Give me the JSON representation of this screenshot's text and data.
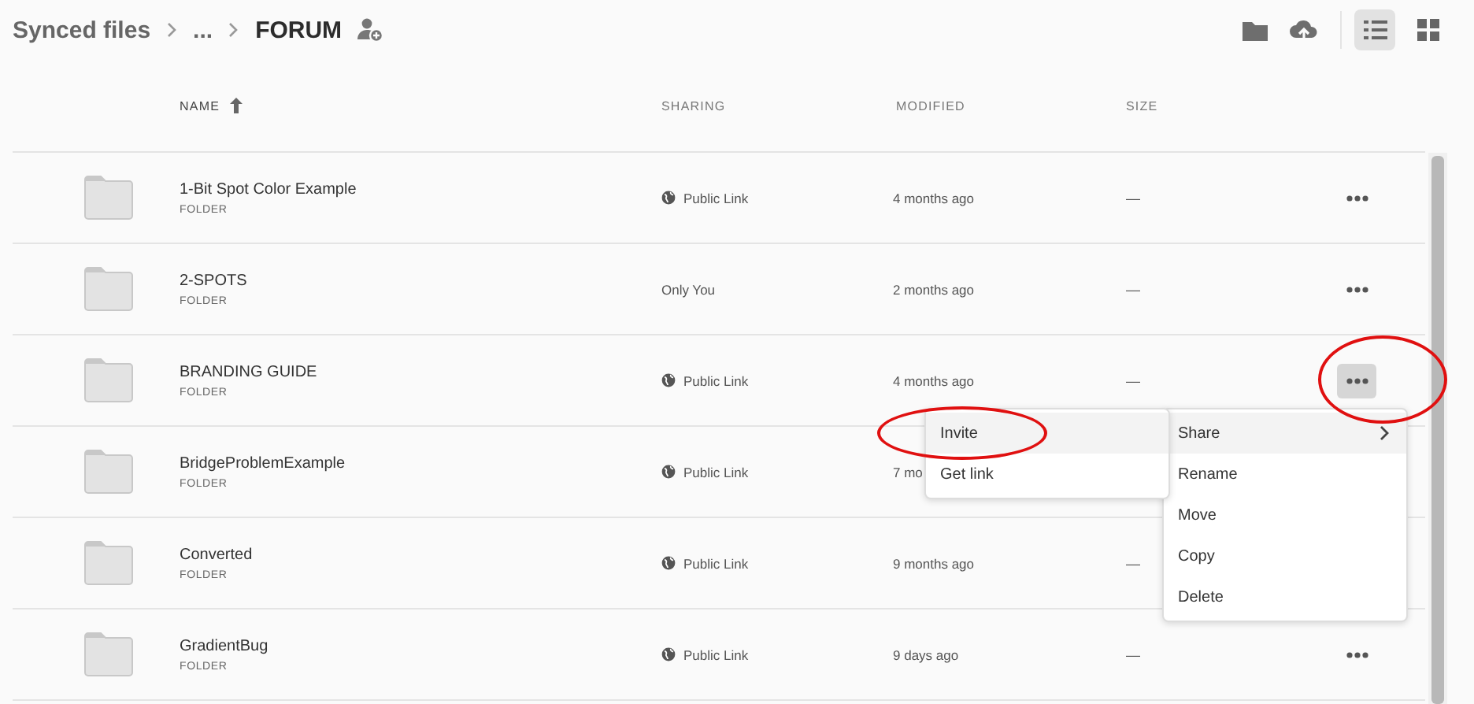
{
  "breadcrumbs": [
    {
      "label": "Synced files",
      "current": false
    },
    {
      "label": "...",
      "current": false
    },
    {
      "label": "FORUM",
      "current": true
    }
  ],
  "table": {
    "columns": [
      {
        "label": "NAME",
        "sorted": true
      },
      {
        "label": "SHARING",
        "sorted": false
      },
      {
        "label": "MODIFIED",
        "sorted": false
      },
      {
        "label": "SIZE",
        "sorted": false
      }
    ],
    "rows": [
      {
        "name": "1-Bit Spot Color Example",
        "type": "FOLDER",
        "sharing": "Public Link",
        "kind": "public",
        "modified": "4 months ago",
        "size": "—",
        "more_button": {
          "active": false
        }
      },
      {
        "name": "2-SPOTS",
        "type": "FOLDER",
        "sharing": "Only You",
        "kind": "private",
        "modified": "2 months ago",
        "size": "—",
        "more_button": {
          "active": false
        }
      },
      {
        "name": "BRANDING GUIDE",
        "type": "FOLDER",
        "sharing": "Public Link",
        "kind": "public",
        "modified": "4 months ago",
        "size": "—",
        "more_button": {
          "active": true
        }
      },
      {
        "name": "BridgeProblemExample",
        "type": "FOLDER",
        "sharing": "Public Link",
        "kind": "public",
        "modified": "7 mo"
      },
      {
        "name": "Converted",
        "type": "FOLDER",
        "sharing": "Public Link",
        "kind": "public",
        "modified": "9 months ago",
        "size": "—"
      },
      {
        "name": "GradientBug",
        "type": "FOLDER",
        "sharing": "Public Link",
        "kind": "public",
        "modified": "9 days ago",
        "size": "—",
        "more_button": {
          "active": false
        }
      }
    ]
  },
  "context_menu": {
    "items": [
      {
        "label": "Share",
        "selected": true,
        "submenu": true
      },
      {
        "label": "Rename",
        "selected": false,
        "submenu": false
      },
      {
        "label": "Move",
        "selected": false,
        "submenu": false
      },
      {
        "label": "Copy",
        "selected": false,
        "submenu": false
      },
      {
        "label": "Delete",
        "selected": false,
        "submenu": false
      }
    ]
  },
  "submenu": {
    "items": [
      {
        "label": "Invite",
        "selected": true
      },
      {
        "label": "Get link",
        "selected": false
      }
    ]
  },
  "view_toggle": {
    "list_selected": true
  }
}
